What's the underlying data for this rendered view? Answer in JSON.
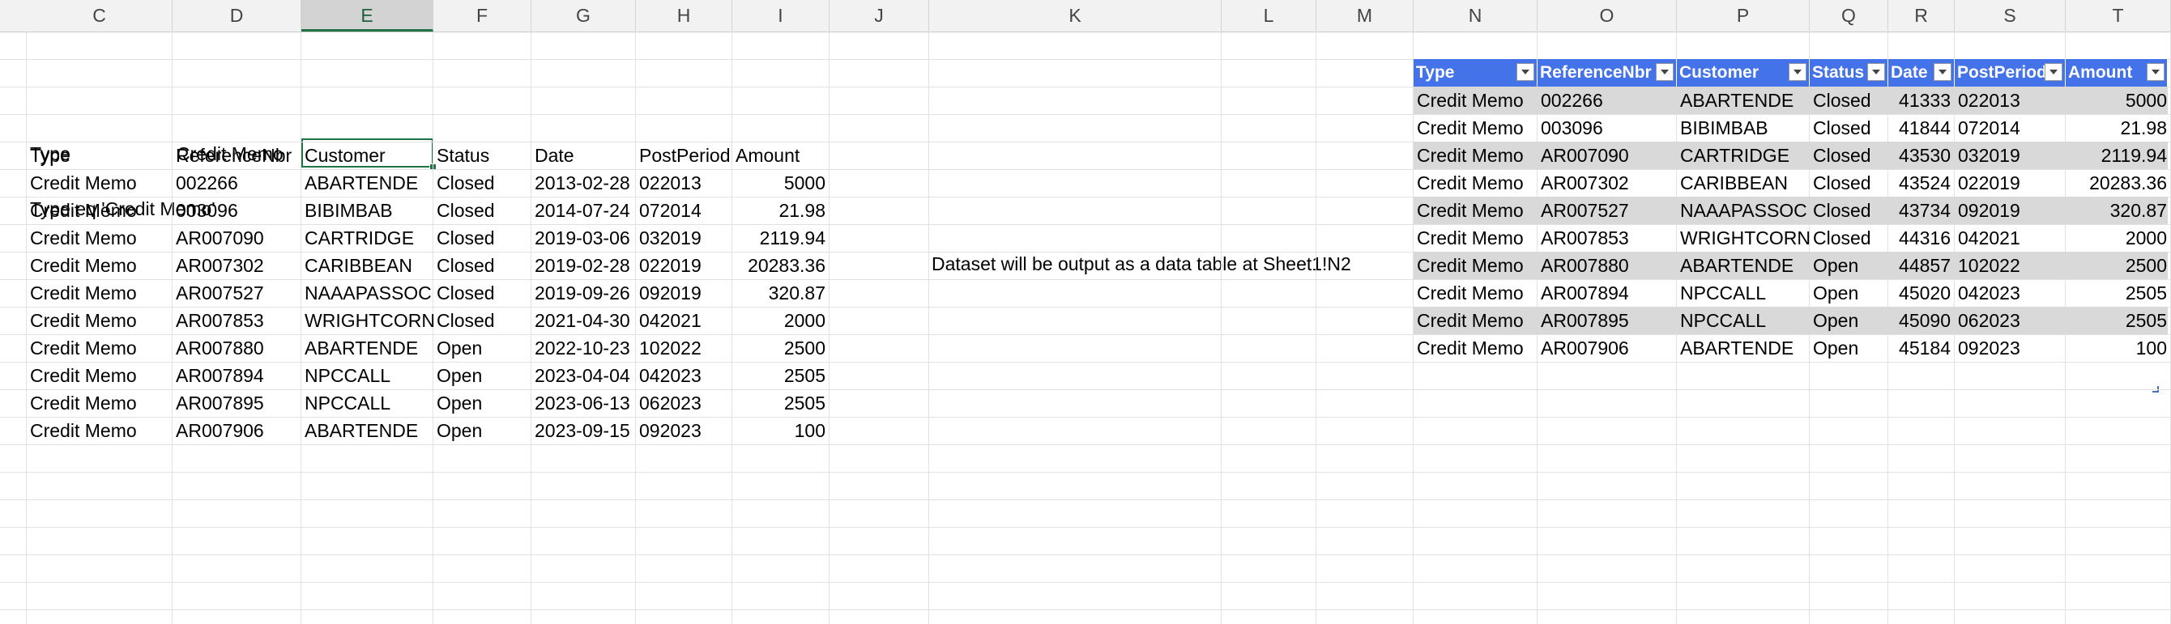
{
  "columns": [
    "C",
    "D",
    "E",
    "F",
    "G",
    "H",
    "I",
    "J",
    "K",
    "L",
    "M",
    "N",
    "O",
    "P",
    "Q",
    "R",
    "S",
    "T"
  ],
  "selected_column": "E",
  "criteria": {
    "type_label": "Type",
    "type_value": "Credit Memo",
    "filter_expression": "Type eq 'Credit Memo'"
  },
  "left_table": {
    "headers": [
      "Type",
      "ReferenceNbr",
      "Customer",
      "Status",
      "Date",
      "PostPeriod",
      "Amount"
    ],
    "rows": [
      [
        "Credit Memo",
        "002266",
        "ABARTENDE",
        "Closed",
        "2013-02-28",
        "022013",
        "5000"
      ],
      [
        "Credit Memo",
        "003096",
        "BIBIMBAB",
        "Closed",
        "2014-07-24",
        "072014",
        "21.98"
      ],
      [
        "Credit Memo",
        "AR007090",
        "CARTRIDGE",
        "Closed",
        "2019-03-06",
        "032019",
        "2119.94"
      ],
      [
        "Credit Memo",
        "AR007302",
        "CARIBBEAN",
        "Closed",
        "2019-02-28",
        "022019",
        "20283.36"
      ],
      [
        "Credit Memo",
        "AR007527",
        "NAAAPASSOC",
        "Closed",
        "2019-09-26",
        "092019",
        "320.87"
      ],
      [
        "Credit Memo",
        "AR007853",
        "WRIGHTCORN",
        "Closed",
        "2021-04-30",
        "042021",
        "2000"
      ],
      [
        "Credit Memo",
        "AR007880",
        "ABARTENDE",
        "Open",
        "2022-10-23",
        "102022",
        "2500"
      ],
      [
        "Credit Memo",
        "AR007894",
        "NPCCALL",
        "Open",
        "2023-04-04",
        "042023",
        "2505"
      ],
      [
        "Credit Memo",
        "AR007895",
        "NPCCALL",
        "Open",
        "2023-06-13",
        "062023",
        "2505"
      ],
      [
        "Credit Memo",
        "AR007906",
        "ABARTENDE",
        "Open",
        "2023-09-15",
        "092023",
        "100"
      ]
    ]
  },
  "note": "Dataset will be output as a data table at Sheet1!N2",
  "right_table": {
    "headers": [
      "Type",
      "ReferenceNbr",
      "Customer",
      "Status",
      "Date",
      "PostPeriod",
      "Amount"
    ],
    "rows": [
      [
        "Credit Memo",
        "002266",
        "ABARTENDE",
        "Closed",
        "41333",
        "022013",
        "5000"
      ],
      [
        "Credit Memo",
        "003096",
        "BIBIMBAB",
        "Closed",
        "41844",
        "072014",
        "21.98"
      ],
      [
        "Credit Memo",
        "AR007090",
        "CARTRIDGE",
        "Closed",
        "43530",
        "032019",
        "2119.94"
      ],
      [
        "Credit Memo",
        "AR007302",
        "CARIBBEAN",
        "Closed",
        "43524",
        "022019",
        "20283.36"
      ],
      [
        "Credit Memo",
        "AR007527",
        "NAAAPASSOC",
        "Closed",
        "43734",
        "092019",
        "320.87"
      ],
      [
        "Credit Memo",
        "AR007853",
        "WRIGHTCORN",
        "Closed",
        "44316",
        "042021",
        "2000"
      ],
      [
        "Credit Memo",
        "AR007880",
        "ABARTENDE",
        "Open",
        "44857",
        "102022",
        "2500"
      ],
      [
        "Credit Memo",
        "AR007894",
        "NPCCALL",
        "Open",
        "45020",
        "042023",
        "2505"
      ],
      [
        "Credit Memo",
        "AR007895",
        "NPCCALL",
        "Open",
        "45090",
        "062023",
        "2505"
      ],
      [
        "Credit Memo",
        "AR007906",
        "ABARTENDE",
        "Open",
        "45184",
        "092023",
        "100"
      ]
    ]
  },
  "colors": {
    "table_header": "#4472e8",
    "band_row": "#d9d9d9",
    "selection": "#217346"
  }
}
